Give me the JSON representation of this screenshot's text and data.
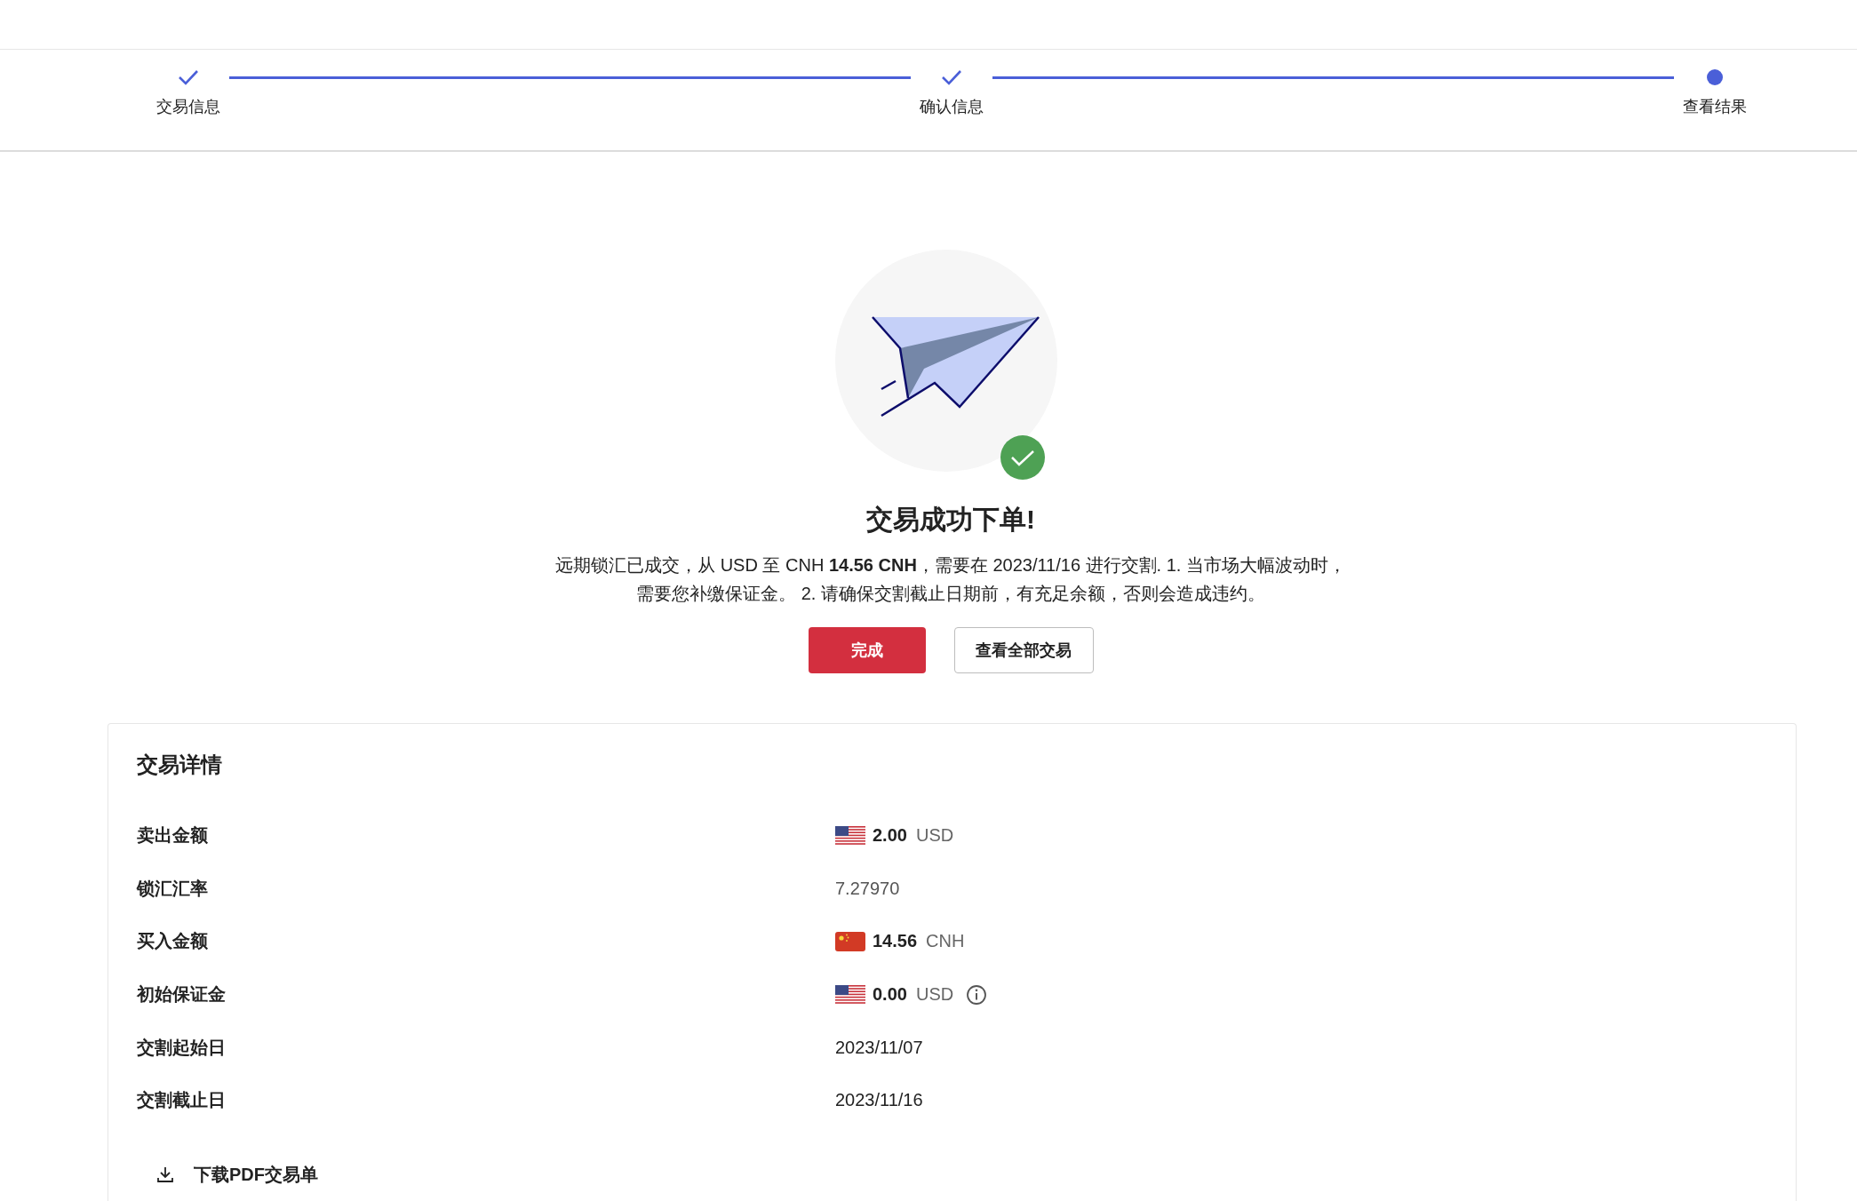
{
  "stepper": {
    "steps": [
      {
        "label": "交易信息",
        "kind": "done"
      },
      {
        "label": "确认信息",
        "kind": "done"
      },
      {
        "label": "查看结果",
        "kind": "current"
      }
    ]
  },
  "result": {
    "title": "交易成功下单!",
    "message": "远期锁汇已成交，从 USD 至 CNH **14.56 CNH**，需要在 2023/11/16 进行交割. 1. 当市场大幅波动时，需要您补缴保证金。 2. 请确保交割截止日期前，有充足余额，否则会造成违约。",
    "buttons": [
      {
        "label": "完成",
        "kind": "primary"
      },
      {
        "label": "查看全部交易",
        "kind": "secondary"
      }
    ]
  },
  "details": {
    "title": "交易详情",
    "rows": [
      {
        "label": "卖出金额",
        "kind": "amount",
        "flag": {
          "kind": "us"
        },
        "amount": "2.00",
        "currency": "USD",
        "info": false
      },
      {
        "label": "锁汇汇率",
        "kind": "plain",
        "value": "7.27970"
      },
      {
        "label": "买入金额",
        "kind": "amount",
        "flag": {
          "kind": "cn"
        },
        "amount": "14.56",
        "currency": "CNH",
        "info": false
      },
      {
        "label": "初始保证金",
        "kind": "amount",
        "flag": {
          "kind": "us"
        },
        "amount": "0.00",
        "currency": "USD",
        "info": true
      },
      {
        "label": "交割起始日",
        "kind": "date",
        "value": "2023/11/07"
      },
      {
        "label": "交割截止日",
        "kind": "date",
        "value": "2023/11/16"
      }
    ],
    "download": "下载PDF交易单"
  }
}
